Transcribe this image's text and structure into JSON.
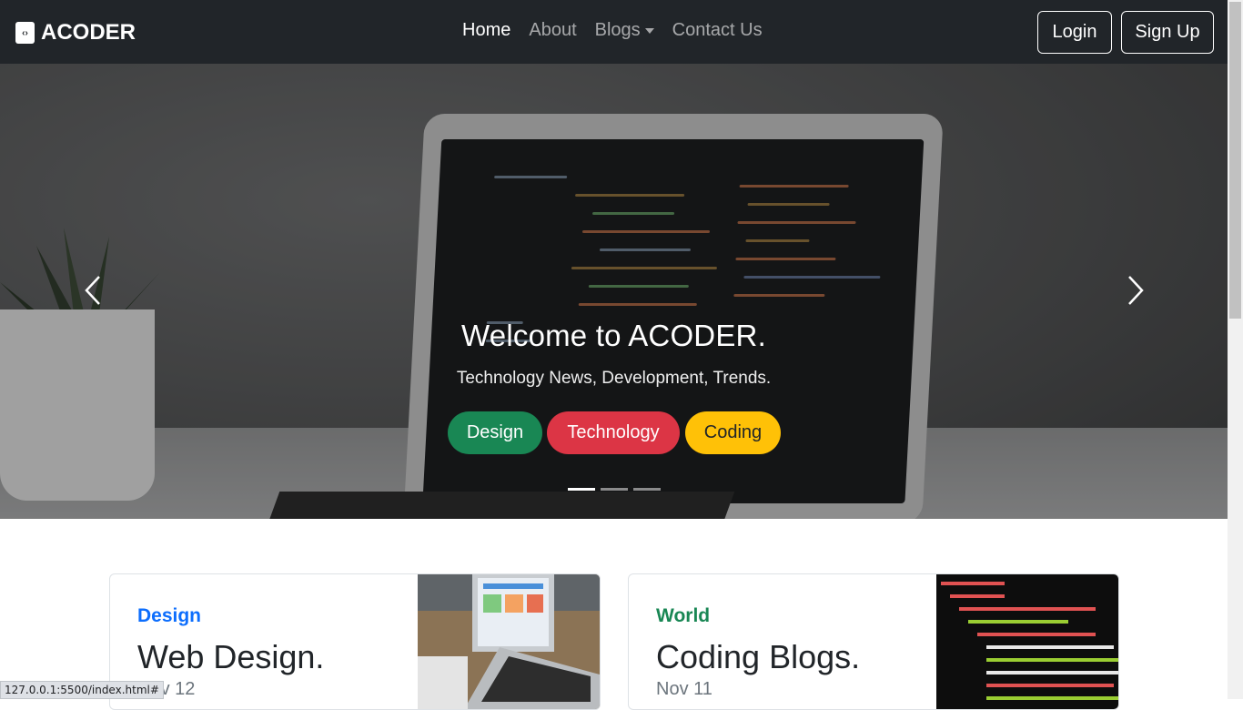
{
  "navbar": {
    "brand": "ACODER",
    "brand_icon": "code-icon",
    "links": [
      "Home",
      "About",
      "Blogs",
      "Contact Us"
    ],
    "login": "Login",
    "signup": "Sign Up"
  },
  "hero": {
    "title": "Welcome to ACODER.",
    "subtitle": "Technology News, Development, Trends.",
    "buttons": [
      {
        "label": "Design",
        "color": "#198754",
        "text_color": "#ffffff"
      },
      {
        "label": "Technology",
        "color": "#dc3545",
        "text_color": "#ffffff"
      },
      {
        "label": "Coding",
        "color": "#ffc107",
        "text_color": "#212529"
      }
    ],
    "indicators": 3,
    "active_indicator": 0
  },
  "cards": [
    {
      "category": "Design",
      "category_color": "#0d6efd",
      "title": "Web Design.",
      "date": "Nov 12"
    },
    {
      "category": "World",
      "category_color": "#198754",
      "title": "Coding Blogs.",
      "date": "Nov 11"
    }
  ],
  "status_bar": "127.0.0.1:5500/index.html#"
}
